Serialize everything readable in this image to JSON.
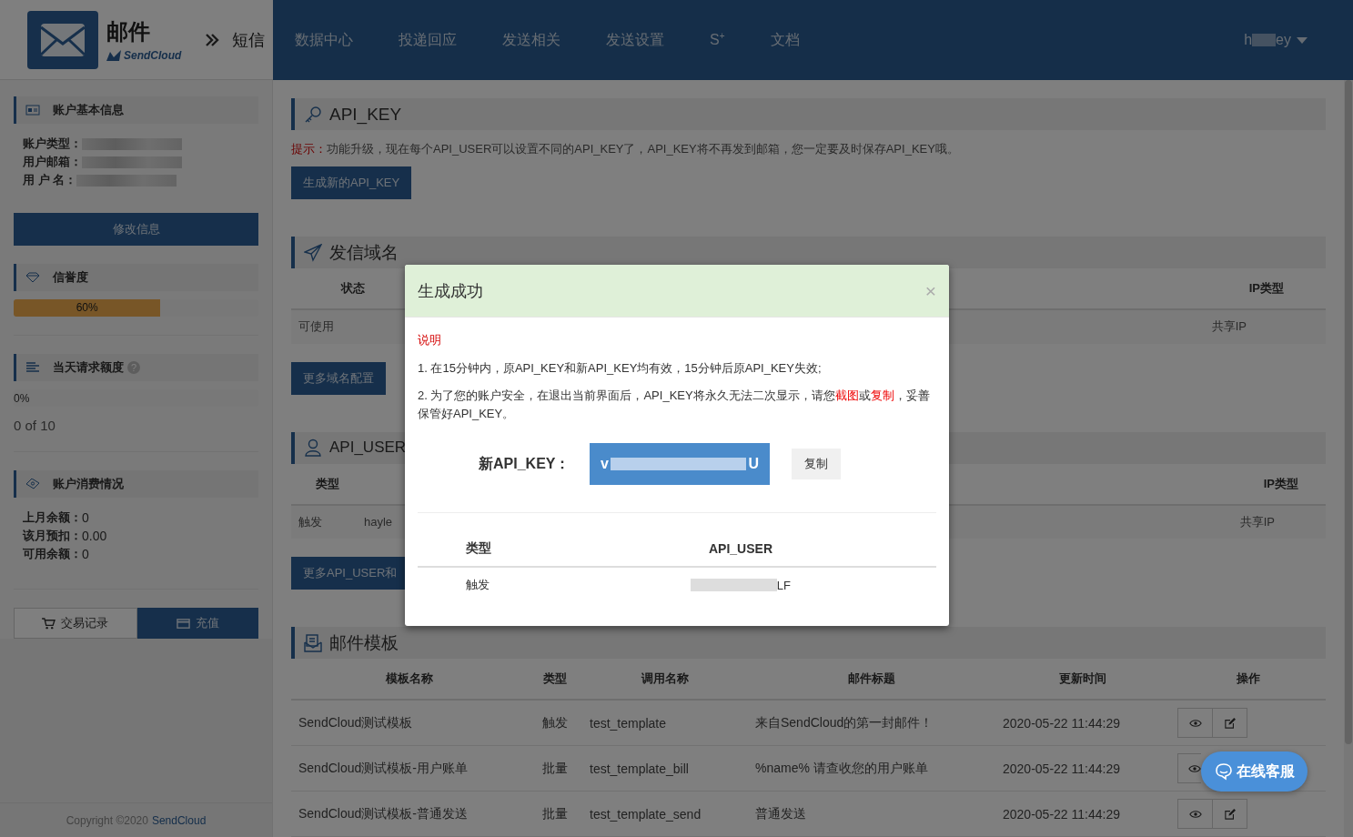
{
  "header": {
    "app_name": "邮件",
    "brand": "SendCloud",
    "breadcrumb": "短信",
    "nav": [
      {
        "label": "数据中心"
      },
      {
        "label": "投递回应"
      },
      {
        "label": "发送相关"
      },
      {
        "label": "发送设置"
      },
      {
        "label": "S$^{+}$"
      },
      {
        "label": "文档"
      }
    ],
    "user": {
      "prefix": "h",
      "suffix": "ey"
    }
  },
  "sidebar": {
    "account": {
      "title": "账户基本信息",
      "fields": [
        {
          "label": "账户类型："
        },
        {
          "label": "用户邮箱："
        },
        {
          "label": "用 户 名："
        }
      ],
      "button": "修改信息"
    },
    "reputation": {
      "title": "信誉度",
      "level": 0.6,
      "reading": "60%"
    },
    "quota": {
      "title": "当天请求额度",
      "help": "?",
      "level": 0,
      "reading": "0%",
      "usage": "0 of 10"
    },
    "billing": {
      "title": "账户消费情况",
      "rows": [
        {
          "label": "上月余额：",
          "value": "0"
        },
        {
          "label": "该月预扣：",
          "value": "0.00"
        },
        {
          "label": "可用余额：",
          "value": "0"
        }
      ]
    },
    "buttons": [
      {
        "label": "交易记录",
        "kind": "history"
      },
      {
        "label": "充值",
        "kind": "recharge"
      }
    ],
    "footer": {
      "text": "Copyright ©2020",
      "link": "SendCloud"
    }
  },
  "api_key": {
    "title": "API_KEY",
    "tip_label": "提示：",
    "tip": "功能升级，现在每个API_USER可以设置不同的API_KEY了，API_KEY将不再发到邮箱，您一定要及时保存API_KEY哦。",
    "button": "生成新的API_KEY"
  },
  "domains": {
    "title": "发信域名",
    "columns": [
      "状态",
      "IP类型"
    ],
    "row": [
      "可使用",
      "共享IP"
    ],
    "button": "更多域名配置"
  },
  "api_users": {
    "title": "API_USER",
    "columns": [
      "类型",
      "IP类型"
    ],
    "row": [
      "触发",
      "hayle",
      "共享IP"
    ],
    "button": "更多API_USER和"
  },
  "templates": {
    "title": "邮件模板",
    "columns": [
      "模板名称",
      "类型",
      "调用名称",
      "邮件标题",
      "更新时间",
      "操作"
    ],
    "rows": [
      [
        "SendCloud测试模板",
        "触发",
        "test_template",
        "来自SendCloud的第一封邮件！",
        "2020-05-22 11:44:29"
      ],
      [
        "SendCloud测试模板-用户账单",
        "批量",
        "test_template_bill",
        "%name% 请查收您的用户账单",
        "2020-05-22 11:44:29"
      ],
      [
        "SendCloud测试模板-普通发送",
        "批量",
        "test_template_send",
        "普通发送",
        "2020-05-22 11:44:29"
      ]
    ]
  },
  "modal": {
    "title": "生成成功",
    "close": "×",
    "note_title": "说明",
    "notes": [
      "1. 在15分钟内，原API_KEY和新API_KEY均有效，15分钟后原API_KEY失效;",
      "2. 为了您的账户安全，在退出当前界面后，API_KEY将永久无法二次显示，请您**截图**或**复制**，妥善保管好API_KEY。"
    ],
    "key_label": "新API_KEY：",
    "key_prefix": "v",
    "key_suffix": "U",
    "copy_button": "复制",
    "columns": [
      "类型",
      "API_USER"
    ],
    "row": {
      "type": "触发",
      "user_suffix": "LF"
    }
  },
  "chat": {
    "label": "在线客服"
  }
}
